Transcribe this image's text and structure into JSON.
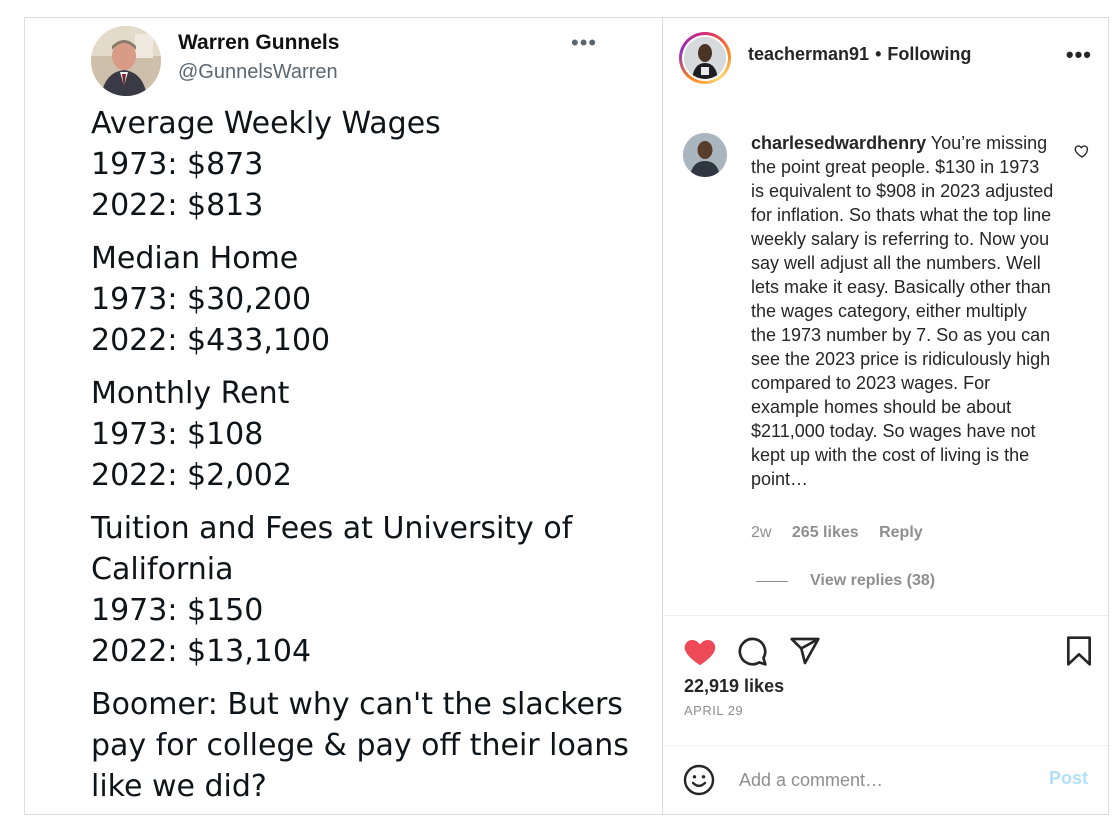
{
  "tweet": {
    "name": "Warren Gunnels",
    "handle": "@GunnelsWarren",
    "blocks": [
      {
        "lines": [
          "Average Weekly Wages",
          "1973: $873",
          "2022: $813"
        ]
      },
      {
        "lines": [
          "Median Home",
          "1973: $30,200",
          "2022: $433,100"
        ]
      },
      {
        "lines": [
          "Monthly Rent",
          "1973: $108",
          "2022: $2,002"
        ]
      },
      {
        "lines": [
          "Tuition and Fees at University of California",
          "1973: $150",
          "2022: $13,104"
        ]
      },
      {
        "lines": [
          "Boomer: But why can't the slackers pay for college & pay off their loans like we did?"
        ]
      }
    ]
  },
  "header": {
    "username": "teacherman91",
    "separator": "•",
    "follow_status": "Following"
  },
  "comment": {
    "username": "charlesedwardhenry",
    "text": "You’re missing the point great people. $130 in 1973 is equivalent to $908 in 2023 adjusted for inflation. So thats what the top line weekly salary is referring to. Now you say well adjust all the numbers. Well lets make it easy. Basically other than the wages category, either multiply the 1973 number by 7. So as you can see the 2023 price is ridiculously high compared to 2023 wages. For example homes should be about $211,000 today. So wages have not kept up with the cost of living is the point…",
    "age": "2w",
    "likes": "265 likes",
    "reply_label": "Reply",
    "view_replies": "View replies (38)"
  },
  "post": {
    "likes": "22,919 likes",
    "date": "APRIL 29",
    "liked_color": "#ed4956"
  },
  "composer": {
    "placeholder": "Add a comment…",
    "post_label": "Post"
  },
  "icons": {
    "more": "more-horizontal-icon",
    "like": "heart-icon",
    "comment": "comment-bubble-icon",
    "share": "paper-plane-icon",
    "save": "bookmark-icon",
    "emoji": "smiley-icon"
  }
}
